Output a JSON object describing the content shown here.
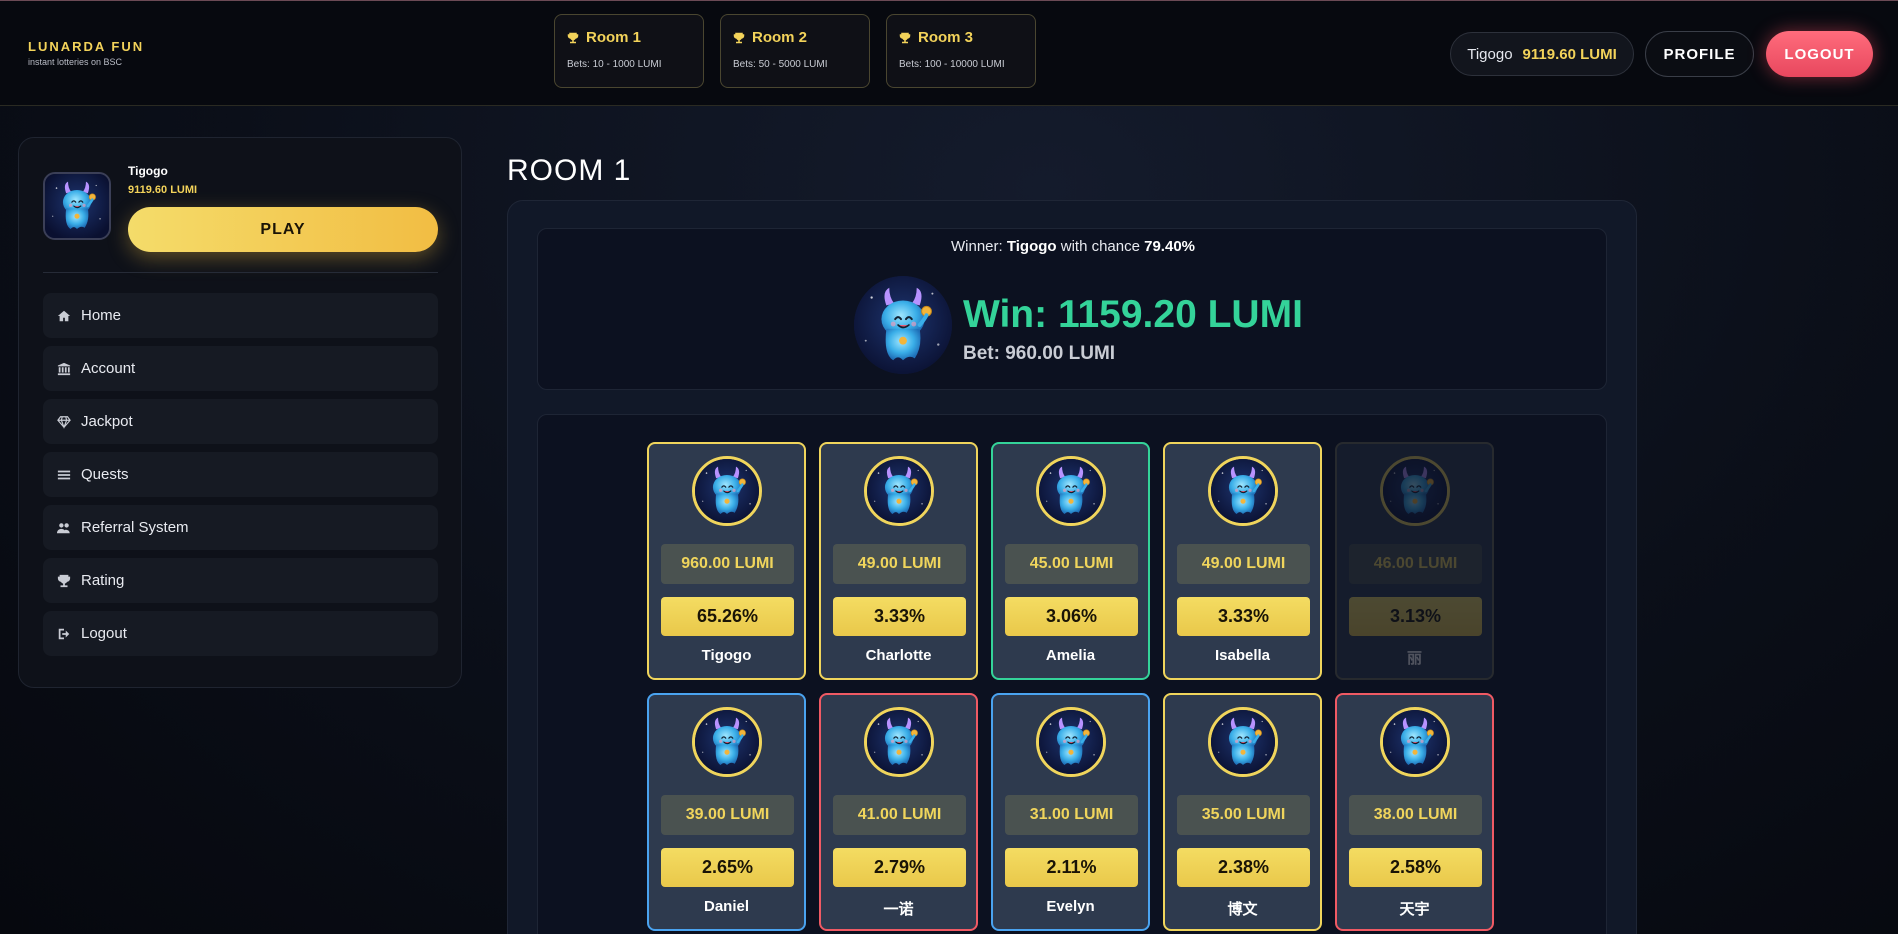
{
  "brand": {
    "title": "LUNARDA FUN",
    "subtitle": "instant lotteries on BSC"
  },
  "rooms": [
    {
      "name": "Room 1",
      "bets": "Bets: 10 - 1000 LUMI"
    },
    {
      "name": "Room 2",
      "bets": "Bets: 50 - 5000 LUMI"
    },
    {
      "name": "Room 3",
      "bets": "Bets: 100 - 10000 LUMI"
    }
  ],
  "header": {
    "username": "Tigogo",
    "balance": "9119.60 LUMI",
    "profile_label": "PROFILE",
    "logout_label": "LOGOUT"
  },
  "sidebar": {
    "username": "Tigogo",
    "balance": "9119.60 LUMI",
    "play_label": "PLAY",
    "items": [
      {
        "label": "Home",
        "icon": "home-icon"
      },
      {
        "label": "Account",
        "icon": "bank-icon"
      },
      {
        "label": "Jackpot",
        "icon": "diamond-icon"
      },
      {
        "label": "Quests",
        "icon": "list-icon"
      },
      {
        "label": "Referral System",
        "icon": "users-icon"
      },
      {
        "label": "Rating",
        "icon": "trophy-icon"
      },
      {
        "label": "Logout",
        "icon": "sign-out-icon"
      }
    ]
  },
  "main": {
    "room_title": "ROOM 1",
    "winner": {
      "prefix": "Winner: ",
      "name": "Tigogo",
      "middle": " with chance ",
      "chance": "79.40%",
      "win_amount": "Win: 1159.20 LUMI",
      "bet": "Bet: 960.00 LUMI"
    },
    "players": [
      {
        "bet": "960.00 LUMI",
        "chance": "65.26%",
        "name": "Tigogo"
      },
      {
        "bet": "49.00 LUMI",
        "chance": "3.33%",
        "name": "Charlotte"
      },
      {
        "bet": "45.00 LUMI",
        "chance": "3.06%",
        "name": "Amelia"
      },
      {
        "bet": "49.00 LUMI",
        "chance": "3.33%",
        "name": "Isabella"
      },
      {
        "bet": "46.00 LUMI",
        "chance": "3.13%",
        "name": "丽"
      },
      {
        "bet": "39.00 LUMI",
        "chance": "2.65%",
        "name": "Daniel"
      },
      {
        "bet": "41.00 LUMI",
        "chance": "2.79%",
        "name": "一诺"
      },
      {
        "bet": "31.00 LUMI",
        "chance": "2.11%",
        "name": "Evelyn"
      },
      {
        "bet": "35.00 LUMI",
        "chance": "2.38%",
        "name": "博文"
      },
      {
        "bet": "38.00 LUMI",
        "chance": "2.58%",
        "name": "天宇"
      }
    ]
  },
  "colors": {
    "accent_gold": "#f3d35a",
    "win_green": "#34d399",
    "logout_red": "#f05a6c"
  }
}
